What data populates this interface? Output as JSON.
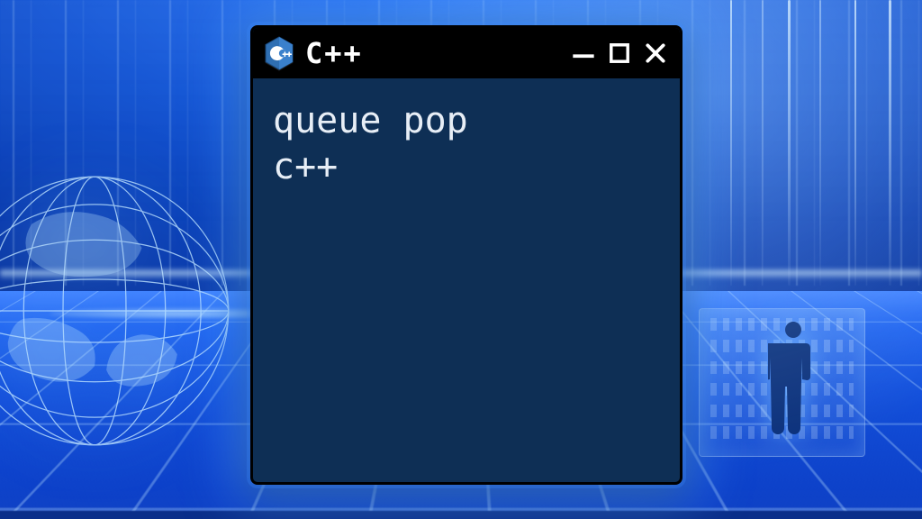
{
  "titlebar": {
    "label": "C++",
    "logo_name": "cpp-logo"
  },
  "window_controls": {
    "minimize_name": "minimize-icon",
    "maximize_name": "maximize-icon",
    "close_name": "close-icon"
  },
  "content": {
    "line1": "queue pop",
    "line2": "c++"
  },
  "colors": {
    "window_bg": "#0e2f55",
    "titlebar_bg": "#000000",
    "text": "#e7eef6",
    "accent_glow": "#4fa0ff"
  }
}
